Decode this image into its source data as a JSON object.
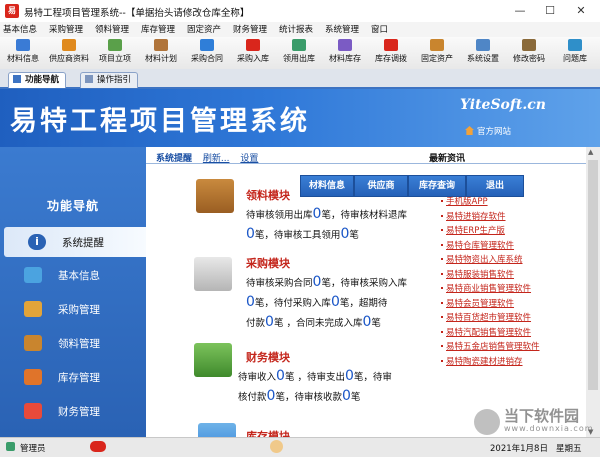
{
  "window": {
    "title": "易特工程项目管理系统--【单据抬头请修改仓库全称】",
    "app_icon_text": "易",
    "minimize": "—",
    "maximize": "☐",
    "close": "✕"
  },
  "menu": [
    "基本信息",
    "采购管理",
    "领料管理",
    "库存管理",
    "固定资产",
    "财务管理",
    "统计报表",
    "系统管理",
    "窗口"
  ],
  "toolbar": [
    {
      "label": "材料信息",
      "color": "#3a7bd5"
    },
    {
      "label": "供应商资料",
      "color": "#e08a1e"
    },
    {
      "label": "项目立项",
      "color": "#5aa04a"
    },
    {
      "label": "材料计划",
      "color": "#b0743a"
    },
    {
      "label": "采购合同",
      "color": "#2f7ed8"
    },
    {
      "label": "采购入库",
      "color": "#d9261c"
    },
    {
      "label": "领用出库",
      "color": "#3a9c6a"
    },
    {
      "label": "材料库存",
      "color": "#7b5bc4"
    },
    {
      "label": "库存调拨",
      "color": "#d9261c"
    },
    {
      "label": "固定资产",
      "color": "#c9852e"
    },
    {
      "label": "系统设置",
      "color": "#4f86c6"
    },
    {
      "label": "修改密码",
      "color": "#8a6a3a"
    },
    {
      "label": "问题库",
      "color": "#2f8fc9"
    }
  ],
  "tabs": [
    {
      "label": "功能导航",
      "active": true
    },
    {
      "label": "操作指引",
      "active": false
    }
  ],
  "banner": {
    "title": "易特工程项目管理系统",
    "brand": "YiteSoft.cn",
    "home_link": "官方网站"
  },
  "nav": {
    "header": "功能导航",
    "items": [
      {
        "label": "系统提醒",
        "color": "#2a62b4",
        "active": true
      },
      {
        "label": "基本信息",
        "color": "#4ba3e0",
        "active": false
      },
      {
        "label": "采购管理",
        "color": "#e2a43a",
        "active": false
      },
      {
        "label": "领料管理",
        "color": "#c9852e",
        "active": false
      },
      {
        "label": "库存管理",
        "color": "#e0742a",
        "active": false
      },
      {
        "label": "财务管理",
        "color": "#e84a3a",
        "active": false
      }
    ]
  },
  "content": {
    "subnav": {
      "title": "系统提醒",
      "refresh": "刷新...",
      "settings": "设置"
    },
    "news_title": "最新资讯",
    "quick_buttons": [
      "材料信息",
      "供应商",
      "库存查询",
      "退出"
    ],
    "modules": [
      {
        "title": "领料模块",
        "lines": [
          [
            [
              "待审核领用出库",
              ""
            ],
            [
              "",
              "0"
            ],
            [
              "笔，待审核材料退库",
              ""
            ]
          ],
          [
            [
              "",
              "0"
            ],
            [
              "笔，待审核工具领用",
              ""
            ],
            [
              "",
              "0"
            ],
            [
              "笔",
              ""
            ]
          ]
        ]
      },
      {
        "title": "采购模块",
        "lines": [
          [
            [
              "待审核采购合同",
              ""
            ],
            [
              "",
              "0"
            ],
            [
              "笔，待审核采购入库",
              ""
            ]
          ],
          [
            [
              "",
              "0"
            ],
            [
              "笔，待付采购入库",
              ""
            ],
            [
              "",
              "0"
            ],
            [
              "笔，超期待",
              ""
            ]
          ],
          [
            [
              "付款",
              ""
            ],
            [
              "",
              "0"
            ],
            [
              "笔 ，合同未完成入库",
              ""
            ],
            [
              "",
              "0"
            ],
            [
              "笔",
              ""
            ]
          ]
        ]
      },
      {
        "title": "财务模块",
        "lines": [
          [
            [
              "待审收入",
              ""
            ],
            [
              "",
              "0"
            ],
            [
              "笔 ，待审支出",
              ""
            ],
            [
              "",
              "0"
            ],
            [
              "笔，待审",
              ""
            ]
          ],
          [
            [
              "核付款",
              ""
            ],
            [
              "",
              "0"
            ],
            [
              "笔，待审核收款",
              ""
            ],
            [
              "",
              "0"
            ],
            [
              "笔",
              ""
            ]
          ]
        ]
      },
      {
        "title": "库存模块",
        "lines": []
      }
    ],
    "news": [
      "手机版APP",
      "易特进销存软件",
      "易特ERP生产版",
      "易特仓库管理软件",
      "易特物资出入库系统",
      "易特服装销售软件",
      "易特商业销售管理软件",
      "易特会员管理软件",
      "易特百货超市管理软件",
      "易特汽配销售管理软件",
      "易特五金店销售管理软件",
      "易特陶瓷建材进销存"
    ]
  },
  "status": {
    "user": "管理员",
    "date": "2021年1月8日",
    "weekday": "星期五"
  },
  "watermark": {
    "text": "当下软件园",
    "sub": "www.downxia.com"
  }
}
